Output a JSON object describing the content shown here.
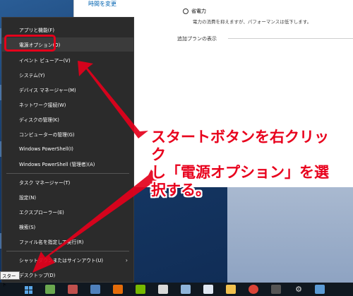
{
  "settings": {
    "link_change_time": "時間を変更",
    "radio_label": "省電力",
    "radio_desc": "電力の消費を抑えますが、パフォーマンスは低下します。",
    "add_plan_heading": "追加プランの表示"
  },
  "menu": {
    "items": [
      {
        "label": "アプリと機能(F)"
      },
      {
        "label": "電源オプション(O)"
      },
      {
        "label": "イベント ビューアー(V)"
      },
      {
        "label": "システム(Y)"
      },
      {
        "label": "デバイス マネージャー(M)"
      },
      {
        "label": "ネットワーク接続(W)"
      },
      {
        "label": "ディスクの管理(K)"
      },
      {
        "label": "コンピューターの管理(G)"
      },
      {
        "label": "Windows PowerShell(I)"
      },
      {
        "label": "Windows PowerShell (管理者)(A)"
      },
      {
        "label": "タスク マネージャー(T)"
      },
      {
        "label": "設定(N)"
      },
      {
        "label": "エクスプローラー(E)"
      },
      {
        "label": "検索(S)"
      },
      {
        "label": "ファイル名を指定して実行(R)"
      },
      {
        "label": "シャットダウンまたはサインアウト(U)",
        "submenu_arrow": "›"
      },
      {
        "label": "デスクトップ(D)"
      }
    ]
  },
  "annotation": {
    "line1": "スタートボタンを右クリック",
    "line2": "し「電源オプション」を選",
    "line3": "択する。"
  },
  "taskbar": {
    "start_tooltip": "スタート"
  },
  "colors": {
    "accent_red": "#e4001b",
    "menu_bg": "#2b2b2b",
    "taskbar_bg": "#101820"
  }
}
